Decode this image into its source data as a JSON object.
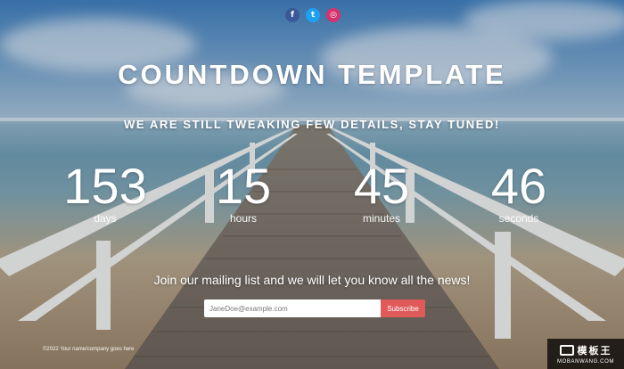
{
  "social": {
    "facebook_icon": "f",
    "twitter_icon": "t",
    "instagram_icon": "◎",
    "colors": {
      "facebook": "#3b5998",
      "twitter": "#1da1f2",
      "instagram": "#d6336c"
    }
  },
  "header": {
    "title": "COUNTDOWN TEMPLATE",
    "subtitle": "WE ARE STILL TWEAKING FEW DETAILS, STAY TUNED!"
  },
  "countdown": [
    {
      "value": "153",
      "label": "days"
    },
    {
      "value": "15",
      "label": "hours"
    },
    {
      "value": "45",
      "label": "minutes"
    },
    {
      "value": "46",
      "label": "seconds"
    }
  ],
  "mailing": {
    "text": "Join our mailing list and we will let you know all the news!",
    "email_placeholder": "JaneDoe@example.com",
    "subscribe_label": "Subscribe",
    "accent": "#e05a5a"
  },
  "footer": {
    "copyright": "©2022 Your name/company goes here"
  },
  "watermark": {
    "brand": "模板王",
    "url": "MOBANWANG.COM"
  }
}
